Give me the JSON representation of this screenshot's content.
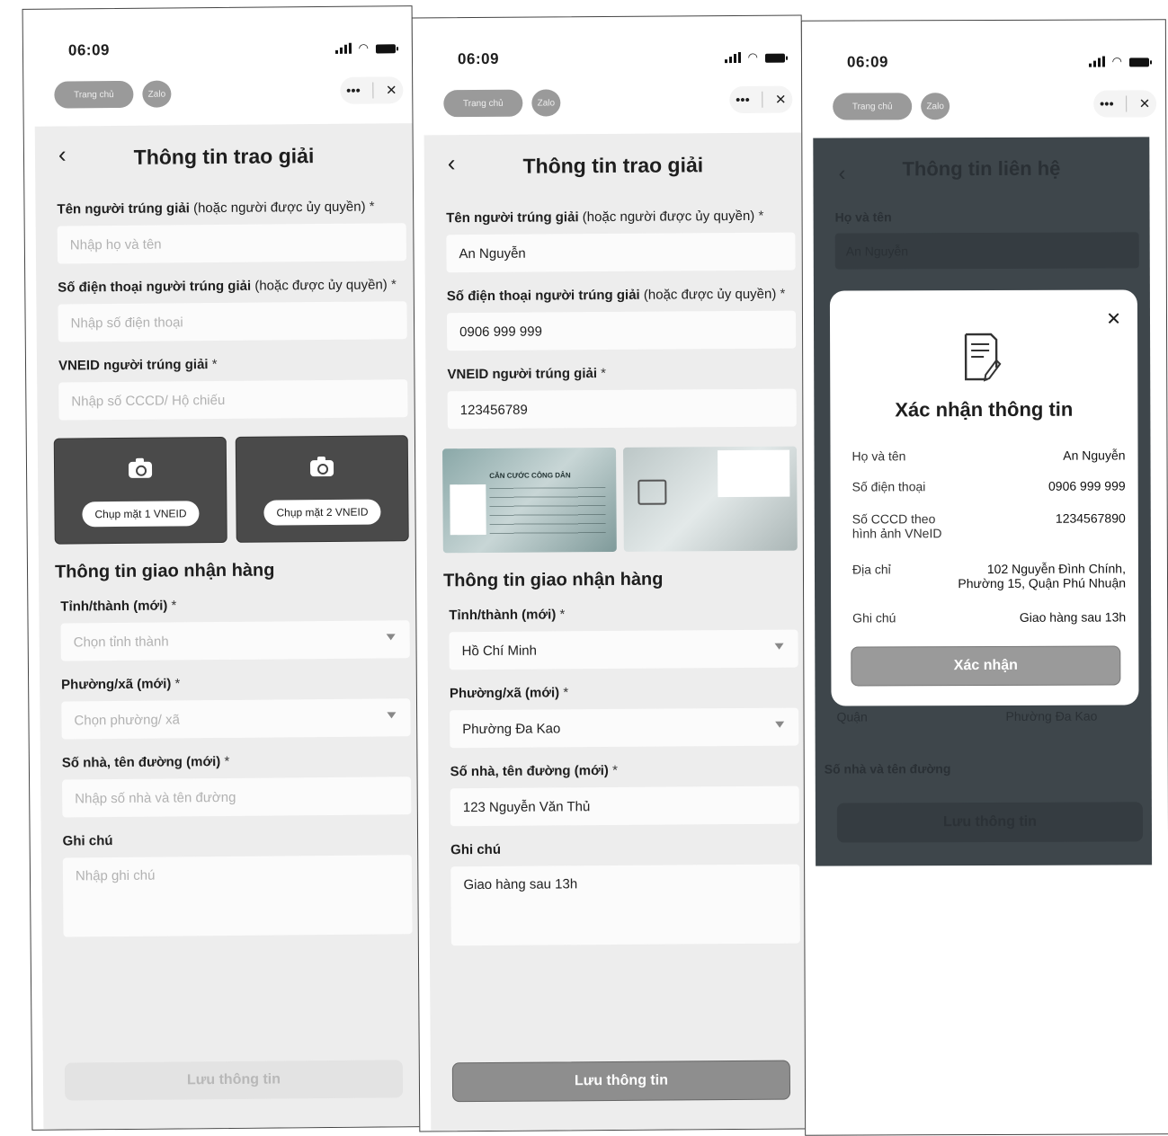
{
  "status": {
    "time": "06:09"
  },
  "topbar": {
    "home_label": "Trang chủ",
    "zalo_label": "Zalo",
    "more": "•••",
    "close": "✕"
  },
  "form": {
    "title": "Thông tin trao giải",
    "winner_name_label": "Tên người trúng giải",
    "winner_name_note": "(hoặc người được ủy quyền)",
    "winner_name_placeholder": "Nhập họ và tên",
    "phone_label": "Số điện thoại người trúng giải",
    "phone_note": "(hoặc được ủy quyền)",
    "phone_placeholder": "Nhập số điện thoại",
    "vneid_label": "VNEID người trúng giải",
    "vneid_placeholder": "Nhập số CCCD/ Hộ chiếu",
    "capture_front": "Chụp mặt 1 VNEID",
    "capture_back": "Chụp mặt 2 VNEID",
    "delivery_title": "Thông tin giao nhận hàng",
    "province_label": "Tỉnh/thành (mới)",
    "province_placeholder": "Chọn tỉnh thành",
    "ward_label": "Phường/xã (mới)",
    "ward_placeholder": "Chọn phường/ xã",
    "street_label": "Số nhà, tên đường (mới)",
    "street_placeholder": "Nhập số nhà và tên đường",
    "note_label": "Ghi chú",
    "note_placeholder": "Nhập ghi chú",
    "save_label": "Lưu thông tin",
    "required": "*"
  },
  "filled": {
    "name": "An Nguyễn",
    "phone": "0906 999 999",
    "vneid": "123456789",
    "card_title": "CĂN CƯỚC CÔNG DÂN",
    "province": "Hồ Chí Minh",
    "ward": "Phường Đa Kao",
    "street": "123 Nguyễn Văn Thủ",
    "note": "Giao hàng sau 13h"
  },
  "contact": {
    "title": "Thông tin liên hệ",
    "name_label": "Họ và tên",
    "name_value": "An Nguyễn",
    "district": "Quận",
    "ward_value": "Phường Đa Kao",
    "street_label": "Số nhà và tên đường",
    "save_label": "Lưu thông tin"
  },
  "confirm": {
    "title": "Xác nhận thông tin",
    "close": "✕",
    "rows": [
      {
        "k": "Họ và tên",
        "v": "An Nguyễn"
      },
      {
        "k": "Số điện thoại",
        "v": "0906 999 999"
      },
      {
        "k": "Số CCCD theo hình ảnh VNeID",
        "v": "1234567890"
      },
      {
        "k": "Địa chỉ",
        "v": "102 Nguyễn Đình Chính, Phường 15, Quận Phú Nhuận"
      },
      {
        "k": "Ghi chú",
        "v": "Giao hàng sau 13h"
      }
    ],
    "button": "Xác nhận"
  }
}
